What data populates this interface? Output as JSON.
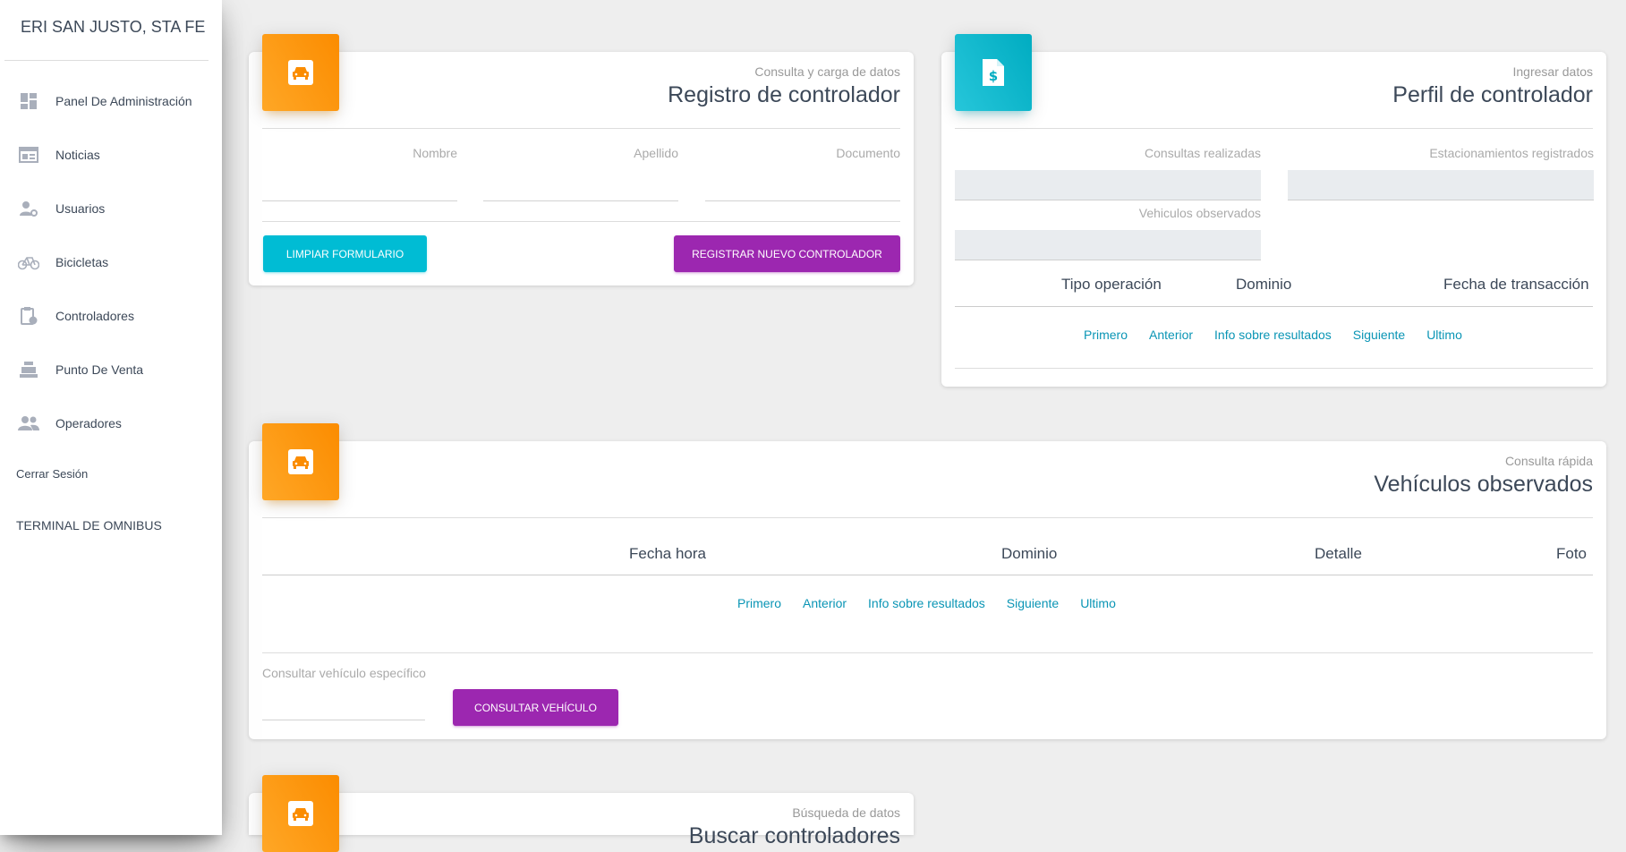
{
  "sidebar": {
    "brand": "ERI SAN JUSTO, STA FE",
    "items": [
      {
        "label": "Panel De Administración",
        "icon": "dashboard-icon"
      },
      {
        "label": "Noticias",
        "icon": "newspaper-icon"
      },
      {
        "label": "Usuarios",
        "icon": "user-settings-icon"
      },
      {
        "label": "Bicicletas",
        "icon": "bicycle-icon"
      },
      {
        "label": "Controladores",
        "icon": "clipboard-clock-icon"
      },
      {
        "label": "Punto De Venta",
        "icon": "cash-register-icon"
      },
      {
        "label": "Operadores",
        "icon": "people-icon"
      }
    ],
    "logout": "Cerrar Sesión",
    "terminal": "TERMINAL DE OMNIBUS"
  },
  "registro": {
    "category": "Consulta y carga de datos",
    "title": "Registro de controlador",
    "fields": {
      "nombre": "Nombre",
      "apellido": "Apellido",
      "documento": "Documento"
    },
    "btn_clear": "LIMPIAR FORMULARIO",
    "btn_register": "REGISTRAR NUEVO CONTROLADOR"
  },
  "perfil": {
    "category": "Ingresar datos",
    "title": "Perfil de controlador",
    "consultas_label": "Consultas realizadas",
    "estacionamientos_label": "Estacionamientos registrados",
    "vehiculos_label": "Vehiculos observados",
    "columns": [
      "Tipo operación",
      "Dominio",
      "Fecha de transacción"
    ],
    "pager": [
      "Primero",
      "Anterior",
      "Info sobre resultados",
      "Siguiente",
      "Ultimo"
    ]
  },
  "vehiculos": {
    "category": "Consulta rápida",
    "title": "Vehículos observados",
    "columns": [
      "Fecha hora",
      "Dominio",
      "Detalle",
      "Foto"
    ],
    "pager": [
      "Primero",
      "Anterior",
      "Info sobre resultados",
      "Siguiente",
      "Ultimo"
    ],
    "input_label": "Consultar vehículo específico",
    "btn_consultar": "CONSULTAR VEHÍCULO"
  },
  "buscar": {
    "category": "Búsqueda de datos",
    "title": "Buscar controladores"
  },
  "colors": {
    "orange": "#fb8c00",
    "cyan": "#00acc1",
    "purple": "#9c27b0",
    "link": "#0a95b5"
  }
}
